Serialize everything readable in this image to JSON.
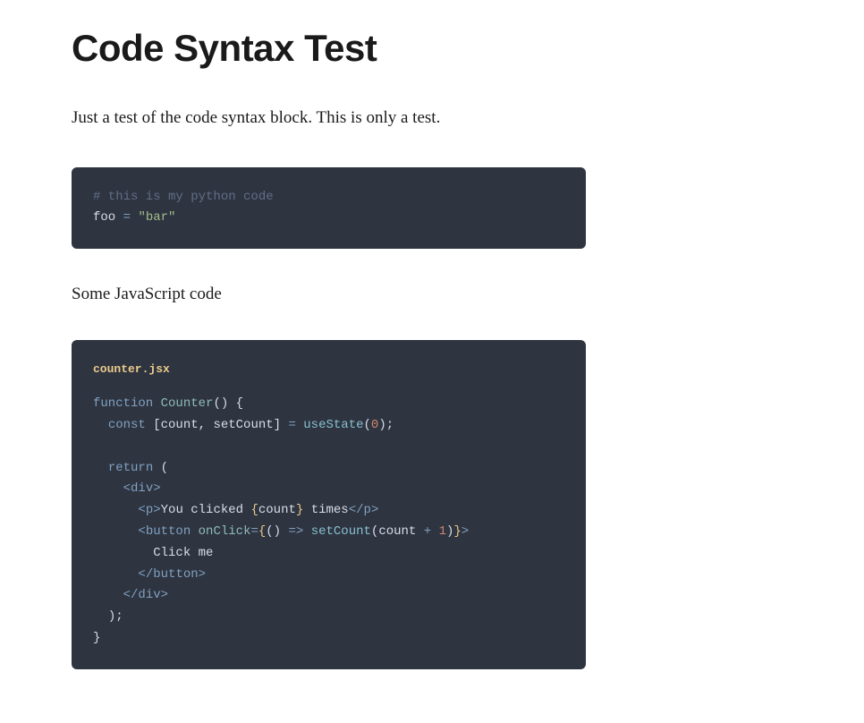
{
  "title": "Code Syntax Test",
  "intro": "Just a test of the code syntax block. This is only a test.",
  "subtitle1": "Some JavaScript code",
  "block1": {
    "line1_comment": "# this is my python code",
    "line2_var": "foo",
    "line2_eq": " = ",
    "line2_str": "\"bar\""
  },
  "block2": {
    "filename": "counter.jsx",
    "l1_kw": "function",
    "l1_sp1": " ",
    "l1_fn": "Counter",
    "l1_rest": "() {",
    "l2_indent": "  ",
    "l2_kw": "const",
    "l2_mid": " [count, setCount] ",
    "l2_eq": "=",
    "l2_sp": " ",
    "l2_fn": "useState",
    "l2_open": "(",
    "l2_num": "0",
    "l2_close": ");",
    "l4_indent": "  ",
    "l4_kw": "return",
    "l4_rest": " (",
    "l5_indent": "    ",
    "l5_lt": "<",
    "l5_tag": "div",
    "l5_gt": ">",
    "l6_indent": "      ",
    "l6_lt": "<",
    "l6_tag": "p",
    "l6_gt": ">",
    "l6_txt1": "You clicked ",
    "l6_bro": "{",
    "l6_var": "count",
    "l6_brc": "}",
    "l6_txt2": " times",
    "l6_lt2": "</",
    "l6_tag2": "p",
    "l6_gt2": ">",
    "l7_indent": "      ",
    "l7_lt": "<",
    "l7_tag": "button",
    "l7_sp": " ",
    "l7_attr": "onClick",
    "l7_eq": "=",
    "l7_bro": "{",
    "l7_paren1": "()",
    "l7_arrow": " => ",
    "l7_fn": "setCount",
    "l7_po": "(",
    "l7_var": "count ",
    "l7_plus": "+",
    "l7_sp2": " ",
    "l7_num": "1",
    "l7_pc": ")",
    "l7_brc": "}",
    "l7_gt": ">",
    "l8_indent": "        ",
    "l8_txt": "Click me",
    "l9_indent": "      ",
    "l9_lt": "</",
    "l9_tag": "button",
    "l9_gt": ">",
    "l10_indent": "    ",
    "l10_lt": "</",
    "l10_tag": "div",
    "l10_gt": ">",
    "l11_indent": "  ",
    "l11_txt": ");",
    "l12_txt": "}"
  }
}
